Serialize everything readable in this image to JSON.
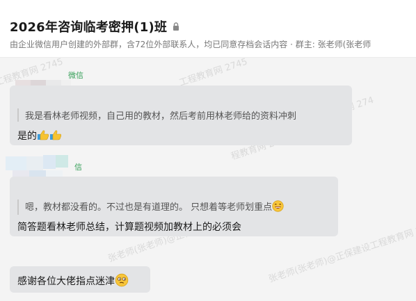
{
  "header": {
    "title": "2026年咨询临考密押(1)班",
    "subtitle": "由企业微信用户创建的外部群，含72位外部联系人，均已同意存档会话内容 · 群主: 张老师(张老师"
  },
  "messages": [
    {
      "sender_tag": "微信",
      "quote": "我是看林老师视频，自己用的教材，然后考前用林老师给的资料冲刺",
      "reply": "是的"
    },
    {
      "sender_tag": "信",
      "quote": "嗯，教材都没看的。不过也是有道理的。 只想着等老师划重点",
      "reply": "简答题看林老师总结，计算题视频加教材上的必须会"
    },
    {
      "reply": "感谢各位大佬指点迷津"
    }
  ],
  "watermarks": [
    "张老师(张老师)@正保建设工程教育网 2745",
    "工程教育网 2745",
    "教育网 274",
    "张老师(张老师)@正保建设工程教育网",
    "张老师(张老师)@正保建设工程教育网 274",
    "程教育网 2745"
  ],
  "colors": {
    "chat_bg": "#f4f4f4",
    "bubble_bg": "#e3e4e6",
    "sender_tag": "#38a05a"
  }
}
